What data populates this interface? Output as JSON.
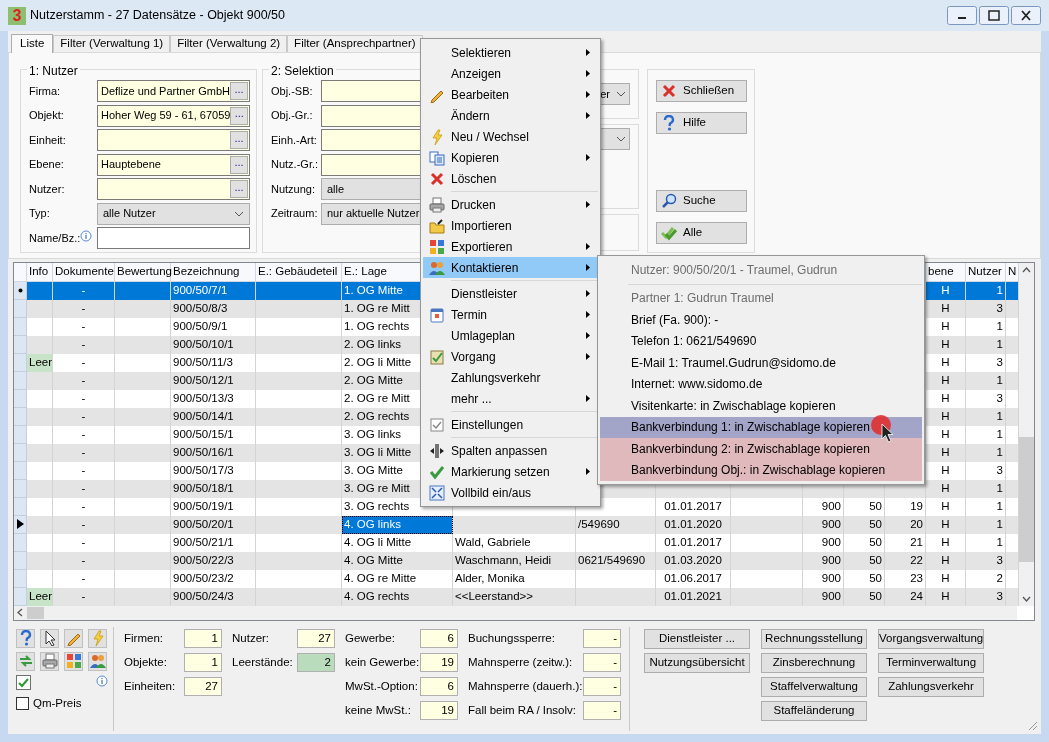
{
  "window": {
    "logo": "3",
    "title": "Nutzerstamm - 27 Datensätze - Objekt 900/50"
  },
  "tabs": [
    {
      "label": "Liste",
      "selected": true
    },
    {
      "label": "Filter (Verwaltung 1)",
      "selected": false
    },
    {
      "label": "Filter (Verwaltung 2)",
      "selected": false
    },
    {
      "label": "Filter (Ansprechpartner)",
      "selected": false
    }
  ],
  "nutzer_group": {
    "title": "1: Nutzer",
    "fields": [
      {
        "label": "Firma:",
        "kind": "lookup",
        "value": "Deflize und Partner GmbH",
        "button": "..."
      },
      {
        "label": "Objekt:",
        "kind": "lookup",
        "value": "Hoher Weg 59 - 61, 67059",
        "button": "..."
      },
      {
        "label": "Einheit:",
        "kind": "lookup",
        "button": "..."
      },
      {
        "label": "Ebene:",
        "kind": "lookup",
        "value": "Hauptebene",
        "button": "..."
      },
      {
        "label": "Nutzer:",
        "kind": "lookup",
        "button": "..."
      },
      {
        "label": "Typ:",
        "kind": "select",
        "value": "alle Nutzer"
      },
      {
        "label": "Name/Bz.:",
        "kind": "text",
        "info": true
      }
    ]
  },
  "selektion_group": {
    "title": "2: Selektion",
    "fields": [
      {
        "label": "Obj.-SB:",
        "kind": "lookup"
      },
      {
        "label": "Obj.-Gr.:",
        "kind": "lookup"
      },
      {
        "label": "Einh.-Art:",
        "kind": "lookup"
      },
      {
        "label": "Nutz.-Gr.:",
        "kind": "lookup"
      },
      {
        "label": "Nutzung:",
        "kind": "select",
        "value": "alle"
      },
      {
        "label": "Zeitraum:",
        "kind": "select",
        "value": "nur aktuelle Nutzer"
      }
    ]
  },
  "side_groups": [
    {
      "kind": "select",
      "value": "er"
    },
    {
      "kind": "select"
    },
    {
      "kind": "empty"
    }
  ],
  "action_buttons": {
    "top": [
      "Schließen",
      "Hilfe"
    ],
    "bottom": [
      "Suche",
      "Alle"
    ]
  },
  "table": {
    "columns": [
      "Info",
      "Dokumente",
      "Bewertung",
      "Bezeichnung",
      "E.: Gebäudeteil",
      "E.: Lage",
      null,
      null,
      null,
      null,
      null,
      null,
      null,
      "bene",
      "Nutzer",
      "N"
    ],
    "rows": [
      {
        "selected": true,
        "current": false,
        "cells": [
          null,
          "-",
          null,
          "900/50/7/1",
          null,
          "1. OG Mitte",
          null,
          null,
          null,
          null,
          null,
          null,
          null,
          "H",
          "1",
          null
        ]
      },
      {
        "selected": false,
        "current": false,
        "cells": [
          null,
          "-",
          null,
          "900/50/8/3",
          null,
          "1. OG re Mitt",
          null,
          null,
          null,
          null,
          null,
          null,
          null,
          "H",
          "3",
          null
        ]
      },
      {
        "selected": false,
        "current": false,
        "cells": [
          null,
          "-",
          null,
          "900/50/9/1",
          null,
          "1. OG rechts",
          null,
          null,
          null,
          null,
          null,
          null,
          null,
          "H",
          "1",
          null
        ]
      },
      {
        "selected": false,
        "current": false,
        "cells": [
          null,
          "-",
          null,
          "900/50/10/1",
          null,
          "2. OG links",
          null,
          null,
          null,
          null,
          null,
          null,
          null,
          "H",
          "1",
          null
        ]
      },
      {
        "selected": false,
        "current": false,
        "cells": [
          "Leer",
          "-",
          null,
          "900/50/11/3",
          null,
          "2. OG li Mitte",
          null,
          null,
          null,
          null,
          null,
          null,
          null,
          "H",
          "3",
          null
        ]
      },
      {
        "selected": false,
        "current": false,
        "cells": [
          null,
          "-",
          null,
          "900/50/12/1",
          null,
          "2. OG Mitte",
          null,
          null,
          null,
          null,
          null,
          null,
          null,
          "H",
          "1",
          null
        ]
      },
      {
        "selected": false,
        "current": false,
        "cells": [
          null,
          "-",
          null,
          "900/50/13/3",
          null,
          "2. OG re Mitt",
          null,
          null,
          null,
          null,
          null,
          null,
          null,
          "H",
          "3",
          null
        ]
      },
      {
        "selected": false,
        "current": false,
        "cells": [
          null,
          "-",
          null,
          "900/50/14/1",
          null,
          "2. OG rechts",
          null,
          null,
          null,
          null,
          null,
          null,
          null,
          "H",
          "1",
          null
        ]
      },
      {
        "selected": false,
        "current": false,
        "cells": [
          null,
          "-",
          null,
          "900/50/15/1",
          null,
          "3. OG links",
          null,
          null,
          null,
          null,
          null,
          null,
          null,
          "H",
          "1",
          null
        ]
      },
      {
        "selected": false,
        "current": false,
        "cells": [
          null,
          "-",
          null,
          "900/50/16/1",
          null,
          "3. OG li Mitte",
          null,
          null,
          null,
          null,
          null,
          null,
          null,
          "H",
          "1",
          null
        ]
      },
      {
        "selected": false,
        "current": false,
        "cells": [
          null,
          "-",
          null,
          "900/50/17/3",
          null,
          "3. OG Mitte",
          null,
          null,
          null,
          null,
          null,
          null,
          null,
          "H",
          "3",
          null
        ]
      },
      {
        "selected": false,
        "current": false,
        "cells": [
          null,
          "-",
          null,
          "900/50/18/1",
          null,
          "3. OG re Mitt",
          null,
          null,
          null,
          null,
          null,
          null,
          null,
          "H",
          "1",
          null
        ]
      },
      {
        "selected": false,
        "current": false,
        "cells": [
          null,
          "-",
          null,
          "900/50/19/1",
          null,
          "3. OG rechts",
          null,
          null,
          "01.01.2017",
          null,
          "900",
          "50",
          "19",
          "H",
          "1",
          null
        ]
      },
      {
        "selected": false,
        "current": true,
        "cells": [
          null,
          "-",
          null,
          "900/50/20/1",
          null,
          "4. OG links",
          null,
          "/549690",
          "01.01.2020",
          null,
          "900",
          "50",
          "20",
          "H",
          "1",
          null
        ]
      },
      {
        "selected": false,
        "current": false,
        "cells": [
          null,
          "-",
          null,
          "900/50/21/1",
          null,
          "4. OG li Mitte",
          "Wald, Gabriele",
          null,
          "01.01.2017",
          null,
          "900",
          "50",
          "21",
          "H",
          "1",
          null
        ]
      },
      {
        "selected": false,
        "current": false,
        "cells": [
          null,
          "-",
          null,
          "900/50/22/3",
          null,
          "4. OG Mitte",
          "Waschmann, Heidi",
          "0621/549690",
          "01.03.2020",
          null,
          "900",
          "50",
          "22",
          "H",
          "3",
          null
        ]
      },
      {
        "selected": false,
        "current": false,
        "cells": [
          null,
          "-",
          null,
          "900/50/23/2",
          null,
          "4. OG re Mitte",
          "Alder, Monika",
          null,
          "01.06.2017",
          null,
          "900",
          "50",
          "23",
          "H",
          "2",
          null
        ]
      },
      {
        "selected": false,
        "current": false,
        "cells": [
          "Leer",
          "-",
          null,
          "900/50/24/3",
          null,
          "4. OG rechts",
          "<<Leerstand>>",
          null,
          "01.01.2021",
          null,
          "900",
          "50",
          "24",
          "H",
          "3",
          null
        ]
      }
    ]
  },
  "context_menu": {
    "items": [
      {
        "kind": "item",
        "label": "Selektieren",
        "submenu": true,
        "highlighted": false
      },
      {
        "kind": "item",
        "label": "Anzeigen",
        "submenu": true,
        "highlighted": false
      },
      {
        "kind": "item",
        "label": "Bearbeiten",
        "submenu": true,
        "highlighted": false
      },
      {
        "kind": "item",
        "label": "Ändern",
        "submenu": true,
        "highlighted": false
      },
      {
        "kind": "item",
        "label": "Neu / Wechsel",
        "submenu": false,
        "highlighted": false
      },
      {
        "kind": "item",
        "label": "Kopieren",
        "submenu": true,
        "highlighted": false
      },
      {
        "kind": "item",
        "label": "Löschen",
        "submenu": false,
        "highlighted": false
      },
      {
        "kind": "separator"
      },
      {
        "kind": "item",
        "label": "Drucken",
        "submenu": true,
        "highlighted": false
      },
      {
        "kind": "item",
        "label": "Importieren",
        "submenu": false,
        "highlighted": false
      },
      {
        "kind": "item",
        "label": "Exportieren",
        "submenu": true,
        "highlighted": false
      },
      {
        "kind": "item",
        "label": "Kontaktieren",
        "submenu": true,
        "highlighted": true
      },
      {
        "kind": "separator"
      },
      {
        "kind": "item",
        "label": "Dienstleister",
        "submenu": true,
        "highlighted": false
      },
      {
        "kind": "item",
        "label": "Termin",
        "submenu": true,
        "highlighted": false
      },
      {
        "kind": "item",
        "label": "Umlageplan",
        "submenu": true,
        "highlighted": false
      },
      {
        "kind": "item",
        "label": "Vorgang",
        "submenu": true,
        "highlighted": false
      },
      {
        "kind": "item",
        "label": "Zahlungsverkehr",
        "submenu": false,
        "highlighted": false
      },
      {
        "kind": "item",
        "label": "mehr ...",
        "submenu": true,
        "highlighted": false
      },
      {
        "kind": "separator"
      },
      {
        "kind": "item",
        "label": "Einstellungen",
        "submenu": false,
        "highlighted": false
      },
      {
        "kind": "separator"
      },
      {
        "kind": "item",
        "label": "Spalten anpassen",
        "submenu": false,
        "highlighted": false
      },
      {
        "kind": "item",
        "label": "Markierung setzen",
        "submenu": true,
        "highlighted": false
      },
      {
        "kind": "item",
        "label": "Vollbild ein/aus",
        "submenu": false,
        "highlighted": false
      }
    ]
  },
  "contact_submenu": {
    "items": [
      {
        "kind": "item",
        "label": "Nutzer: 900/50/20/1 - Traumel, Gudrun",
        "disabled": true,
        "hovered": false,
        "marked": false
      },
      {
        "kind": "separator"
      },
      {
        "kind": "item",
        "label": "Partner 1: Gudrun Traumel",
        "disabled": true,
        "hovered": false,
        "marked": false
      },
      {
        "kind": "item",
        "label": "Brief (Fa. 900): -",
        "disabled": false,
        "hovered": false,
        "marked": false
      },
      {
        "kind": "item",
        "label": "Telefon 1: 0621/549690",
        "disabled": false,
        "hovered": false,
        "marked": false
      },
      {
        "kind": "item",
        "label": "E-Mail 1: Traumel.Gudrun@sidomo.de",
        "disabled": false,
        "hovered": false,
        "marked": false
      },
      {
        "kind": "item",
        "label": "Internet: www.sidomo.de",
        "disabled": false,
        "hovered": false,
        "marked": false
      },
      {
        "kind": "item",
        "label": "Visitenkarte: in Zwischablage kopieren",
        "disabled": false,
        "hovered": false,
        "marked": false
      },
      {
        "kind": "item",
        "label": "Bankverbindung 1: in Zwischablage kopieren",
        "disabled": false,
        "hovered": true,
        "marked": false
      },
      {
        "kind": "item",
        "label": "Bankverbindung 2: in Zwischablage kopieren",
        "disabled": false,
        "hovered": false,
        "marked": true
      },
      {
        "kind": "item",
        "label": "Bankverbindung Obj.: in Zwischablage kopieren",
        "disabled": false,
        "hovered": false,
        "marked": true
      }
    ]
  },
  "toolbar_check": {
    "checked": true
  },
  "qm_preis": {
    "label": "Qm-Preis",
    "checked": false
  },
  "stats": [
    [
      {
        "label": "Firmen:",
        "value": "1",
        "highlight": false
      },
      {
        "label": "Objekte:",
        "value": "1",
        "highlight": false
      },
      {
        "label": "Einheiten:",
        "value": "27",
        "highlight": false
      }
    ],
    [
      {
        "label": "Nutzer:",
        "value": "27",
        "highlight": false
      },
      {
        "label": "Leerstände:",
        "value": "2",
        "highlight": true
      }
    ],
    [
      {
        "label": "Gewerbe:",
        "value": "6",
        "highlight": false
      },
      {
        "label": "kein Gewerbe:",
        "value": "19",
        "highlight": false
      },
      {
        "label": "MwSt.-Option:",
        "value": "6",
        "highlight": false
      },
      {
        "label": "keine MwSt.:",
        "value": "19",
        "highlight": false
      }
    ],
    [
      {
        "label": "Buchungssperre:",
        "value": "-",
        "highlight": false
      },
      {
        "label": "Mahnsperre (zeitw.):",
        "value": "-",
        "highlight": false
      },
      {
        "label": "Mahnsperre (dauerh.):",
        "value": "-",
        "highlight": false
      },
      {
        "label": "Fall beim RA / Insolv:",
        "value": "-",
        "highlight": false
      }
    ]
  ],
  "bottom_buttons": [
    [
      "Dienstleister ...",
      "Nutzungsübersicht"
    ],
    [
      "Rechnungsstellung",
      "Zinsberechnung",
      "Staffelverwaltung",
      "Staffeländerung"
    ],
    [
      "Vorgangsverwaltung",
      "Terminverwaltung",
      "Zahlungsverkehr"
    ]
  ]
}
